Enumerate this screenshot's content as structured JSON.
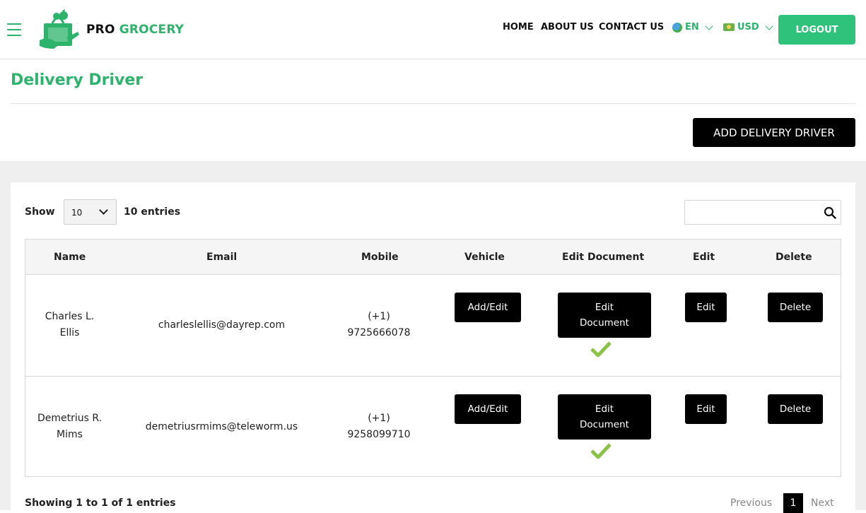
{
  "brand": {
    "name_part1": "PRO",
    "name_part2": "GROCERY",
    "color": "#2db36b"
  },
  "nav": {
    "home": "HOME",
    "about": "ABOUT US",
    "contact": "CONTACT US",
    "language": "EN",
    "currency": "USD",
    "logout": "LOGOUT"
  },
  "page": {
    "title": "Delivery Driver",
    "add_button": "ADD DELIVERY DRIVER"
  },
  "table_controls": {
    "show_label": "Show",
    "page_size": "10",
    "entries_label": "10 entries",
    "search_value": ""
  },
  "table": {
    "headers": [
      "Name",
      "Email",
      "Mobile",
      "Vehicle",
      "Edit Document",
      "Edit",
      "Delete"
    ],
    "rows": [
      {
        "name_line1": "Charles L.",
        "name_line2": "Ellis",
        "email": "charleslellis@dayrep.com",
        "mobile_line1": "(+1)",
        "mobile_line2": "9725666078",
        "vehicle_btn": "Add/Edit",
        "doc_btn_line1": "Edit",
        "doc_btn_line2": "Document",
        "edit_btn": "Edit",
        "delete_btn": "Delete"
      },
      {
        "name_line1": "Demetrius R.",
        "name_line2": "Mims",
        "email": "demetriusrmims@teleworm.us",
        "mobile_line1": "(+1)",
        "mobile_line2": "9258099710",
        "vehicle_btn": "Add/Edit",
        "doc_btn_line1": "Edit",
        "doc_btn_line2": "Document",
        "edit_btn": "Edit",
        "delete_btn": "Delete"
      }
    ]
  },
  "pagination": {
    "info": "Showing 1 to 1 of 1 entries",
    "previous": "Previous",
    "current": "1",
    "next": "Next"
  },
  "colors": {
    "accent": "#2fc27a",
    "check": "#8bc34a"
  }
}
